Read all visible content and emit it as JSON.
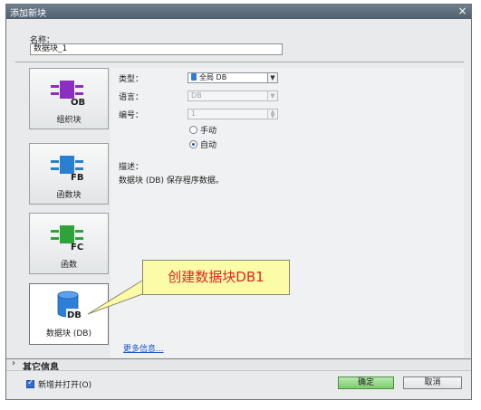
{
  "window": {
    "title": "添加新块",
    "close_glyph": "×"
  },
  "name_field": {
    "label": "名称：",
    "value": "数据块_1"
  },
  "block_types": [
    {
      "id": "ob",
      "code": "OB",
      "label": "组织块",
      "color": "#8a2fbf"
    },
    {
      "id": "fb",
      "code": "FB",
      "label": "函数块",
      "color": "#2a7fd0"
    },
    {
      "id": "fc",
      "code": "FC",
      "label": "函数",
      "color": "#2ea339"
    },
    {
      "id": "db",
      "code": "DB",
      "label": "数据块 (DB)",
      "color": "#2e7fd8"
    }
  ],
  "properties": {
    "type_label": "类型：",
    "type_value": "全局 DB",
    "language_label": "语言：",
    "language_value": "DB",
    "number_label": "编号：",
    "number_value": "1",
    "radio_manual": "手动",
    "radio_auto": "自动",
    "desc_label": "描述：",
    "desc_text": "数据块 (DB) 保存程序数据。",
    "more_link": "更多信息..."
  },
  "callout": {
    "text": "创建数据块DB1"
  },
  "more_info_bar": {
    "chevron": "›",
    "label": "其它信息"
  },
  "footer": {
    "checkbox_label": "新增并打开(O)",
    "ok_label": "确定",
    "cancel_label": "取消"
  }
}
